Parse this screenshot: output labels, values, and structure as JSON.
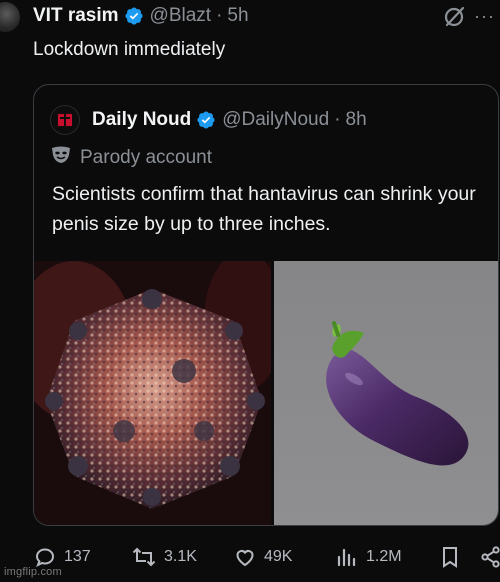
{
  "tweet": {
    "display_name": "VIT rasim",
    "handle": "@Blazt",
    "separator": "·",
    "time": "5h",
    "text": "Lockdown immediately"
  },
  "quoted": {
    "display_name": "Daily Noud",
    "handle": "@DailyNoud",
    "separator": "·",
    "time": "8h",
    "parody_label": "Parody account",
    "text": "Scientists confirm that hantavirus can shrink your penis size by up to three inches.",
    "media": [
      "virus-illustration",
      "eggplant-image"
    ]
  },
  "actions": {
    "replies": "137",
    "reposts": "3.1K",
    "likes": "49K",
    "views": "1.2M"
  },
  "icons": [
    "verified-badge-icon",
    "grok-icon",
    "more-icon",
    "parody-mask-icon",
    "reply-icon",
    "repost-icon",
    "like-icon",
    "views-icon",
    "bookmark-icon",
    "share-icon"
  ],
  "colors": {
    "background": "#0b0b0c",
    "verified": "#1d9bf0",
    "muted": "#8b9096",
    "text": "#e7e9ea"
  },
  "watermark": "imgflip.com"
}
